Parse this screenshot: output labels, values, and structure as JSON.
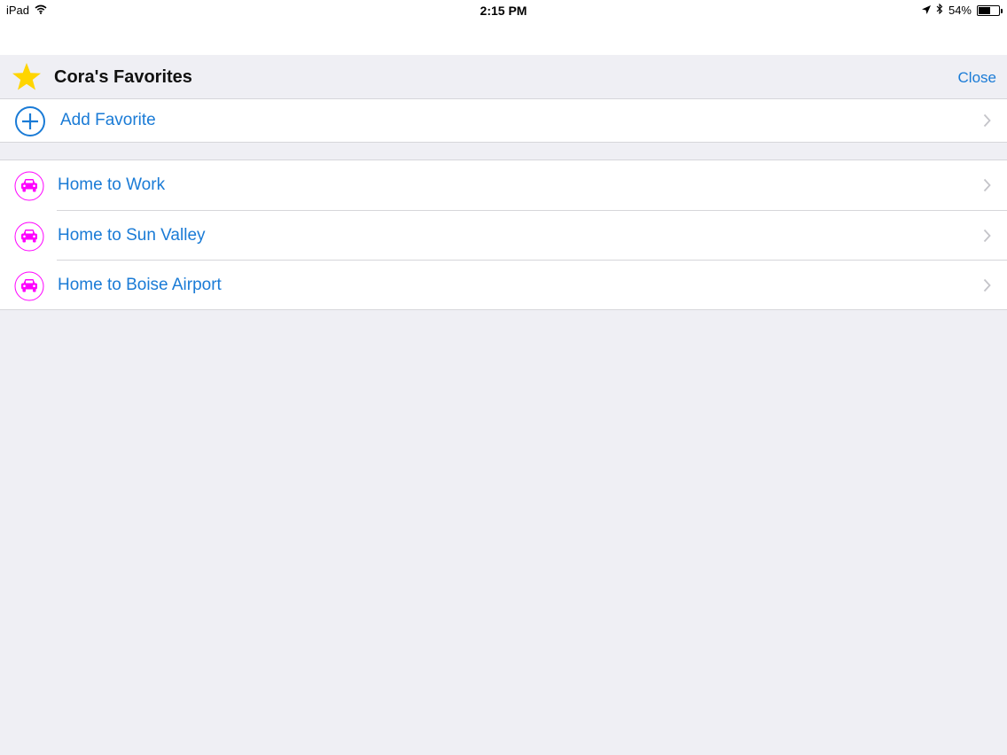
{
  "status_bar": {
    "device": "iPad",
    "time": "2:15 PM",
    "battery_text": "54%",
    "battery_level": 0.54,
    "icons": [
      "wifi-icon",
      "location-arrow-icon",
      "bluetooth-icon",
      "battery-icon"
    ]
  },
  "header": {
    "title": "Cora's Favorites",
    "close_label": "Close",
    "icon": "star-icon"
  },
  "add_favorite": {
    "label": "Add Favorite",
    "icon": "plus-circle-icon"
  },
  "favorites": [
    {
      "label": "Home to Work",
      "icon": "car-icon"
    },
    {
      "label": "Home to Sun Valley",
      "icon": "car-icon"
    },
    {
      "label": "Home to Boise Airport",
      "icon": "car-icon"
    }
  ],
  "colors": {
    "accent": "#1a7bd6",
    "star": "#ffd500",
    "car": "#ff00ff",
    "background": "#efeff4"
  }
}
